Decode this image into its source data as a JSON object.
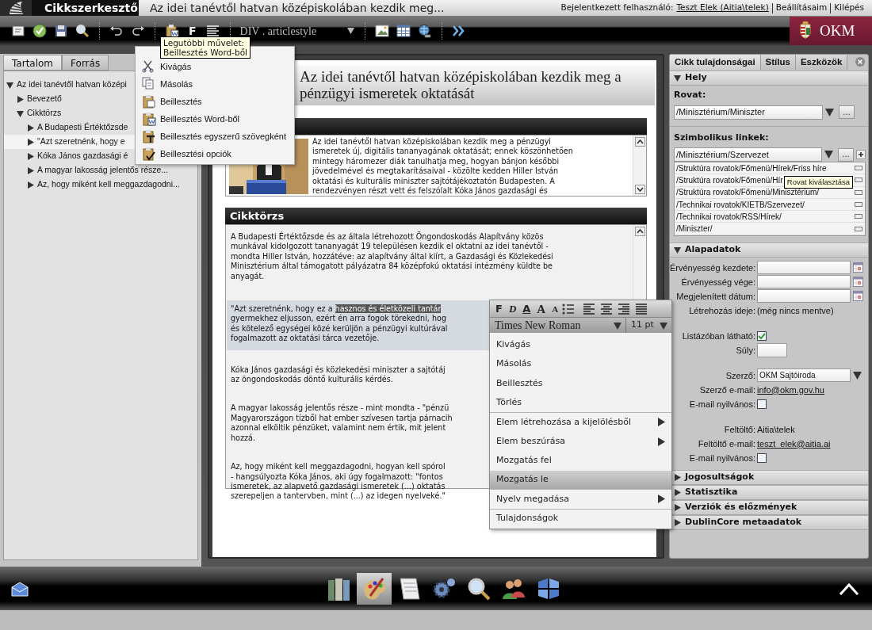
{
  "header": {
    "app_title": "Cikkszerkesztő",
    "document_title": "Az idei tanévtől hatvan középiskolában kezdik meg...",
    "user_label": "Bejelentkezett felhasználó:",
    "user_name": "Teszt Elek (Aitia\\telek)",
    "links": [
      "Beállításaim",
      "Kilépés"
    ]
  },
  "toolbar": {
    "bold_label": "F",
    "style_select": "DIV . articlestyle",
    "logo_text": "OKM"
  },
  "paste_menu": {
    "tooltip": [
      "Legutóbbi művelet:",
      "Beillesztés Word-ből"
    ],
    "items": [
      "Kivágás",
      "Másolás",
      "Beillesztés",
      "Beillesztés Word-ből",
      "Beillesztés egyszerű szövegként",
      "Beillesztési opciók"
    ]
  },
  "left_panel": {
    "tabs": [
      {
        "label": "Tartalom",
        "selected": true
      },
      {
        "label": "Forrás",
        "selected": false
      }
    ],
    "tree": [
      {
        "label": "Az idei tanévtől hatvan középi",
        "expanded": true,
        "selected": false,
        "children": [
          {
            "label": "Bevezető",
            "expanded": false,
            "selected": false
          },
          {
            "label": "Cikktörzs",
            "expanded": true,
            "selected": false,
            "children": [
              {
                "label": "A Budapesti Értéktőzsde",
                "expanded": false,
                "selected": false
              },
              {
                "label": "\"Azt szeretnénk, hogy e",
                "expanded": false,
                "selected": true
              },
              {
                "label": "Kóka János gazdasági é",
                "expanded": false,
                "selected": false
              },
              {
                "label": "A magyar lakosság jelentős része...",
                "expanded": false,
                "selected": false
              },
              {
                "label": "Az, hogy miként kell meggazdagodni...",
                "expanded": false,
                "selected": false
              }
            ]
          }
        ]
      }
    ]
  },
  "editor": {
    "title": "Az idei tanévtől hatvan középiskolában kezdik meg a pénzügyi ismeretek oktatását",
    "intro": {
      "kind": "picture",
      "lines": [
        "Az idei tanévtől hatvan középiskolában kezdik meg a pénzügyi",
        "ismeretek új, digitális tananyagának oktatását; ennek köszönhetően",
        "mintegy háromezer diák tanulhatja meg, hogyan bánjon későbbi",
        "jövedelmével és megtakarításaival - közölte kedden Hiller István",
        "oktatási és kulturális miniszter sajtótájékoztatón Budapesten. A",
        "rendezvényen részt vett és felszólalt Kóka János gazdasági és"
      ]
    },
    "body": {
      "header": "Cikktörzs",
      "paragraphs": [
        {
          "selected": false,
          "lines": [
            {
              "text": "A Budapesti Értéktőzsde és az általa létrehozott Öngondoskodás Alapítvány közös"
            },
            {
              "text": "munkával kidolgozott tananyagát 19 településen kezdik el oktatni az idei tanévtől -"
            },
            {
              "text": "mondta Hiller István, hozzátéve: az alapítvány által kiírt, a Gazdasági és Közlekedési"
            },
            {
              "text": "Minisztérium által támogatott pályázatra 84 középfokú oktatási intézmény küldte be"
            },
            {
              "text": "anyagát."
            }
          ]
        },
        {
          "selected": true,
          "lines": [
            {
              "text": "\"Azt szeretnénk, hogy ez a",
              "highlight": "hasznos és életközeli tantár"
            },
            {
              "text": "gyermekhez eljusson, ezért én arra fogok törekedni, hog"
            },
            {
              "text": "és kötelező egységei közé kerüljön a pénzügyi kultúrával"
            },
            {
              "text": "fogalmazott az oktatási tárca vezetője."
            }
          ]
        },
        {
          "selected": false,
          "lines": [
            {
              "text": "Kóka János gazdasági és közlekedési miniszter a sajtótáj"
            },
            {
              "text": "az öngondoskodás döntő kulturális kérdés."
            }
          ]
        },
        {
          "selected": false,
          "lines": [
            {
              "text": "A magyar lakosság jelentős része - mint mondta - \"pénzü"
            },
            {
              "text": "Magyarországon tízből hat ember szívesen tartja párnacih"
            },
            {
              "text": "azonnal elköltik pénzüket, valamint nem értik, mit jelent"
            },
            {
              "text": "hozzá."
            }
          ]
        },
        {
          "selected": false,
          "lines": [
            {
              "text": "Az, hogy miként kell meggazdagodni, hogyan kell spórol"
            },
            {
              "text": "- hangsúlyozta Kóka János, aki úgy fogalmazott: \"fontos"
            },
            {
              "text": "ismeretek, az alapvető gazdasági ismeretek (...) oktatás"
            },
            {
              "text": "szerepeljen a tantervben, mint (...) az idegen nyelveké.\""
            }
          ]
        }
      ]
    }
  },
  "context_menu": {
    "format_buttons": [
      {
        "kind": "bold",
        "label": "F"
      },
      {
        "kind": "italic",
        "label": "D"
      },
      {
        "kind": "underline",
        "label": "A"
      },
      {
        "kind": "grow",
        "label": "A"
      },
      {
        "kind": "shrink",
        "label": "A"
      }
    ],
    "font": "Times New Roman",
    "size": "11 pt",
    "items": [
      {
        "label": "Kivágás",
        "submenu": false,
        "selected": false,
        "separator_after": false
      },
      {
        "label": "Másolás",
        "submenu": false,
        "selected": false,
        "separator_after": false
      },
      {
        "label": "Beillesztés",
        "submenu": false,
        "selected": false,
        "separator_after": false
      },
      {
        "label": "Törlés",
        "submenu": false,
        "selected": false,
        "separator_after": true
      },
      {
        "label": "Elem létrehozása a kijelölésből",
        "submenu": true,
        "selected": false,
        "separator_after": false
      },
      {
        "label": "Elem beszúrása",
        "submenu": true,
        "selected": false,
        "separator_after": false
      },
      {
        "label": "Mozgatás fel",
        "submenu": false,
        "selected": false,
        "separator_after": false
      },
      {
        "label": "Mozgatás le",
        "submenu": false,
        "selected": true,
        "separator_after": true
      },
      {
        "label": "Nyelv megadása",
        "submenu": true,
        "selected": false,
        "separator_after": true
      },
      {
        "label": "Tulajdonságok",
        "submenu": false,
        "selected": false,
        "separator_after": false
      }
    ]
  },
  "right_panel": {
    "tabs": [
      {
        "label": "Cikk tulajdonságai",
        "selected": true
      },
      {
        "label": "Stílus",
        "selected": false
      },
      {
        "label": "Eszközök",
        "selected": false
      }
    ],
    "sections": [
      {
        "kind": "location",
        "title": "Hely",
        "expanded": true,
        "rovat_label": "Rovat:",
        "rovat_value": "/Minisztérium/Miniszter",
        "links_label": "Szimbolikus linkek:",
        "links_value": "/Minisztérium/Szervezet",
        "tooltip": "Rovat kiválasztása",
        "browse_label": "...",
        "links": [
          "/Struktúra rovatok/Főmenü/Hírek/Friss híre",
          "/Struktúra rovatok/Főmenü/Hír",
          "/Struktúra rovatok/Főmenü/Minisztérium/",
          "/Technikai rovatok/KIETB/Szervezet/",
          "/Technikai rovatok/RSS/Hírek/",
          "/Miniszter/"
        ]
      },
      {
        "kind": "fields",
        "title": "Alapadatok",
        "expanded": true,
        "groups": [
          [
            {
              "kind": "date",
              "label": "Érvényesség kezdete:"
            },
            {
              "kind": "date",
              "label": "Érvényesség vége:"
            },
            {
              "kind": "date",
              "label": "Megjelenített dátum:"
            },
            {
              "kind": "text",
              "label": "Létrehozás ideje:",
              "value": "(még nincs mentve)"
            }
          ],
          [
            {
              "kind": "checkbox",
              "label": "Listázóban látható:",
              "checked": true
            },
            {
              "kind": "input",
              "label": "Súly:"
            }
          ],
          [
            {
              "kind": "select",
              "label": "Szerző:",
              "value": "OKM Sajtóiroda"
            },
            {
              "kind": "link",
              "label": "Szerző e-mail:",
              "value": "info@okm.gov.hu"
            },
            {
              "kind": "checkbox",
              "label": "E-mail nyilvános:",
              "checked": false
            }
          ],
          [
            {
              "kind": "text",
              "label": "Feltöltő:",
              "value": "Aitia\\telek"
            },
            {
              "kind": "link",
              "label": "Feltöltő e-mail:",
              "value": "teszt_elek@aitia.ai"
            },
            {
              "kind": "checkbox",
              "label": "E-mail nyilvános:",
              "checked": false
            }
          ]
        ]
      },
      {
        "kind": "collapsed",
        "title": "Jogosultságok",
        "expanded": false
      },
      {
        "kind": "collapsed",
        "title": "Statisztika",
        "expanded": false
      },
      {
        "kind": "collapsed",
        "title": "Verziók és előzmények",
        "expanded": false
      },
      {
        "kind": "collapsed",
        "title": "DublinCore metaadatok",
        "expanded": false
      }
    ]
  },
  "taskbar": [
    {
      "selected": false
    },
    {
      "selected": true
    },
    {
      "selected": false
    },
    {
      "selected": false
    },
    {
      "selected": false
    },
    {
      "selected": false
    },
    {
      "selected": false
    }
  ]
}
